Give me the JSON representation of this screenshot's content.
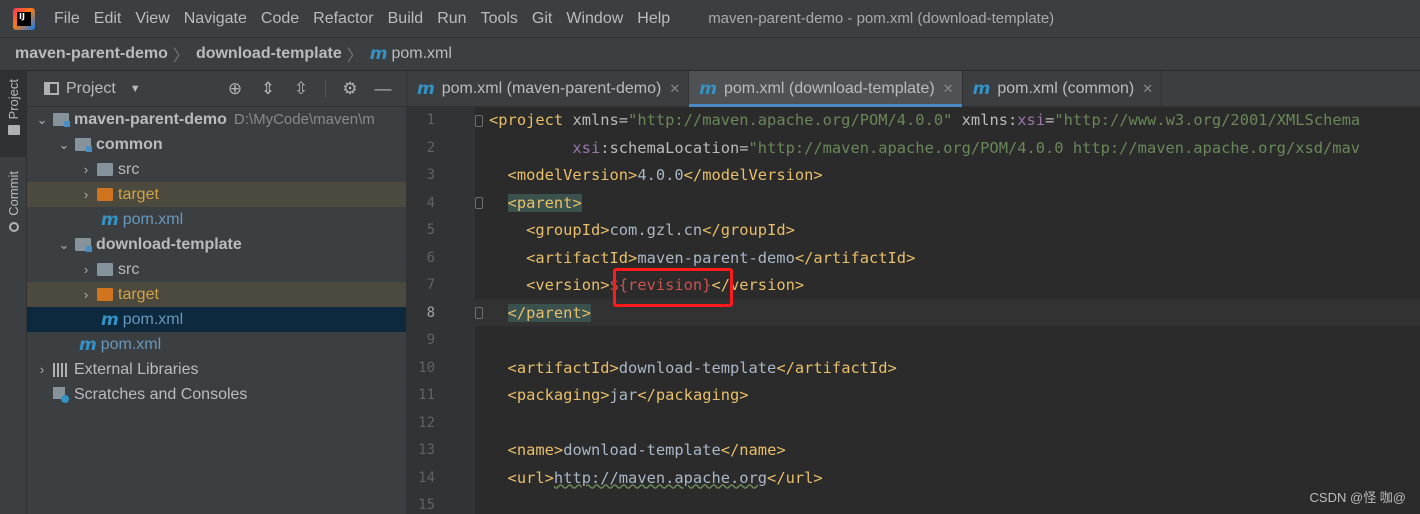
{
  "menubar": {
    "items": [
      "File",
      "Edit",
      "View",
      "Navigate",
      "Code",
      "Refactor",
      "Build",
      "Run",
      "Tools",
      "Git",
      "Window",
      "Help"
    ],
    "window_title": "maven-parent-demo - pom.xml (download-template)"
  },
  "breadcrumb": {
    "items": [
      "maven-parent-demo",
      "download-template"
    ],
    "file": "pom.xml"
  },
  "toolstrip": {
    "project_label": "Project",
    "commit_label": "Commit"
  },
  "project_panel": {
    "title": "Project",
    "tree": [
      {
        "label": "maven-parent-demo",
        "path": "D:\\MyCode\\maven\\m",
        "expanded": true
      },
      {
        "label": "common",
        "expanded": true
      },
      {
        "label": "src"
      },
      {
        "label": "target"
      },
      {
        "label": "pom.xml"
      },
      {
        "label": "download-template",
        "expanded": true
      },
      {
        "label": "src"
      },
      {
        "label": "target"
      },
      {
        "label": "pom.xml"
      },
      {
        "label": "pom.xml"
      },
      {
        "label": "External Libraries"
      },
      {
        "label": "Scratches and Consoles"
      }
    ]
  },
  "editor_tabs": [
    {
      "label": "pom.xml (maven-parent-demo)",
      "active": false
    },
    {
      "label": "pom.xml (download-template)",
      "active": true
    },
    {
      "label": "pom.xml (common)",
      "active": false
    }
  ],
  "editor": {
    "line_numbers": [
      "1",
      "2",
      "3",
      "4",
      "5",
      "6",
      "7",
      "8",
      "9",
      "10",
      "11",
      "12",
      "13",
      "14",
      "15"
    ],
    "current_line": "8",
    "code": {
      "l1_tag": "project",
      "l1_attr1": "xmlns",
      "l1_val1": "\"http://maven.apache.org/POM/4.0.0\"",
      "l1_ns": "xmlns",
      "l1_attr2": "xsi",
      "l1_val2": "\"http://www.w3.org/2001/XMLSchema",
      "l2_ns": "xsi",
      "l2_attr": "schemaLocation",
      "l2_val": "\"http://maven.apache.org/POM/4.0.0 http://maven.apache.org/xsd/mav",
      "model_version_tag": "modelVersion",
      "model_version": "4.0.0",
      "parent_tag": "parent",
      "group_id_tag": "groupId",
      "group_id": "com.gzl.cn",
      "artifact_id_tag": "artifactId",
      "parent_artifact": "maven-parent-demo",
      "version_tag": "version",
      "version": "${revision}",
      "artifact_id": "download-template",
      "packaging_tag": "packaging",
      "packaging": "jar",
      "name_tag": "name",
      "name": "download-template",
      "url_tag": "url",
      "url": "http://maven.apache.org"
    }
  },
  "watermark": "CSDN @怪 咖@"
}
